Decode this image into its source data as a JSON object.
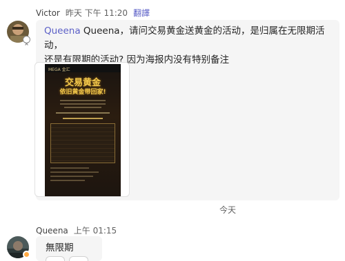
{
  "messages": [
    {
      "sender": "Victor",
      "time": "昨天 下午 11:20",
      "translate_label": "翻譯",
      "mention": "Queena",
      "text_line1": " Queena，请问交易黄金送黄金的活动，是归属在无限期活动，",
      "text_line2": "还是有限期的活动? 因为海报内没有特别备注",
      "attachment": {
        "logo": "MEGA 金汇",
        "title_line1": "交易黄金",
        "title_line2": "依旧黄金带回家!"
      }
    },
    {
      "sender": "Queena",
      "time": "上午 01:15",
      "text": "無限期"
    }
  ],
  "date_divider": "今天",
  "colors": {
    "accent": "#5b5fc7",
    "bubble": "#f5f5f5",
    "status_away": "#ffaa44"
  }
}
